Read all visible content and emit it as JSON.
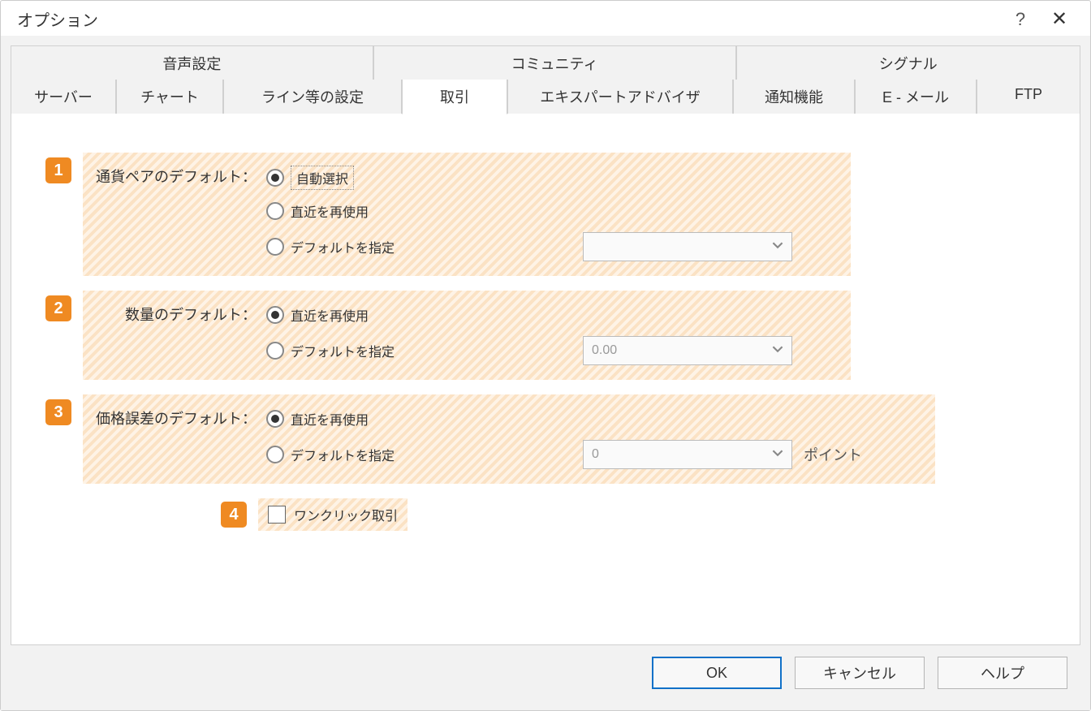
{
  "window": {
    "title": "オプション"
  },
  "tabs_row1": [
    "音声設定",
    "コミュニティ",
    "シグナル"
  ],
  "tabs_row2": [
    "サーバー",
    "チャート",
    "ライン等の設定",
    "取引",
    "エキスパートアドバイザ",
    "通知機能",
    "E - メール",
    "FTP"
  ],
  "active_tab": "取引",
  "badges": {
    "b1": "1",
    "b2": "2",
    "b3": "3",
    "b4": "4"
  },
  "section1": {
    "label": "通貨ペアのデフォルト：",
    "opt1": "自動選択",
    "opt2": "直近を再使用",
    "opt3": "デフォルトを指定",
    "combo_value": ""
  },
  "section2": {
    "label": "数量のデフォルト：",
    "opt1": "直近を再使用",
    "opt2": "デフォルトを指定",
    "combo_value": "0.00"
  },
  "section3": {
    "label": "価格誤差のデフォルト：",
    "opt1": "直近を再使用",
    "opt2": "デフォルトを指定",
    "combo_value": "0",
    "unit": "ポイント"
  },
  "section4": {
    "label": "ワンクリック取引"
  },
  "footer": {
    "ok": "OK",
    "cancel": "キャンセル",
    "help": "ヘルプ"
  }
}
